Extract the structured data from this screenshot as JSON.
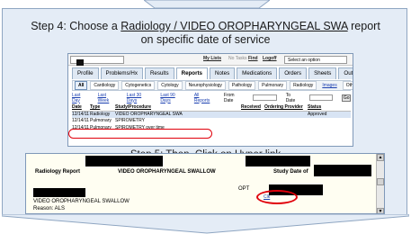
{
  "step4": {
    "prefix": "Step 4: Choose a ",
    "highlight": "Radiology / VIDEO OROPHARYNGEAL SWA",
    "suffix": " report",
    "line2": "on specific date of service"
  },
  "step5": {
    "text": "Step 5: Then, Click on Hyper link"
  },
  "ehr_toolbar": {
    "my_lists": "My Lists",
    "no_tasks": "No Tasks",
    "find": "Find",
    "logoff": "Logoff",
    "select_option": "Select an option"
  },
  "tabs": [
    "Profile",
    "Problems/Hx",
    "Results",
    "Reports",
    "Notes",
    "Medications",
    "Orders",
    "Sheets",
    "Outside Records"
  ],
  "selected_tab": "Reports",
  "subtabs": [
    "All",
    "Cardiology",
    "Cytogenetics",
    "Cytology",
    "Neurophysiology",
    "Pathology",
    "Pulmonary",
    "Radiology",
    "Images",
    "Other reports..."
  ],
  "filters": {
    "last_day": "Last Day",
    "last_week": "Last Week",
    "last_30": "Last 30 Days",
    "last_90": "Last 90 Days",
    "all_reports": "All Reports",
    "from_date": "From Date",
    "to_date": "To Date",
    "go": "Go"
  },
  "grid": {
    "headers": [
      "Date",
      "Type",
      "Study/Procedure",
      "Received",
      "Ordering Provider",
      "Status"
    ],
    "rows": [
      [
        "12/14/11",
        "Radiology",
        "VIDEO OROPHARYNGEAL SWA",
        "",
        "",
        "Approved"
      ],
      [
        "12/14/11",
        "Pulmonary",
        "SPIROMETRY",
        "",
        "",
        ""
      ],
      [
        "12/14/11",
        "Pulmonary",
        "SPIROMETRY over time",
        "",
        "",
        ""
      ]
    ]
  },
  "report": {
    "title": "Radiology Report",
    "study": "VIDEO OROPHARYNGEAL SWALLOW",
    "study_date_label": "Study Date of",
    "opt_label": "OPT",
    "line": "VIDEO OROPHARYNGEAL SWALLOW",
    "reason": "Reason: ALS",
    "link": "Clk"
  },
  "colors": {
    "accent": "#e0000b",
    "panel": "#e4ecf6",
    "border": "#8fa6c2"
  }
}
